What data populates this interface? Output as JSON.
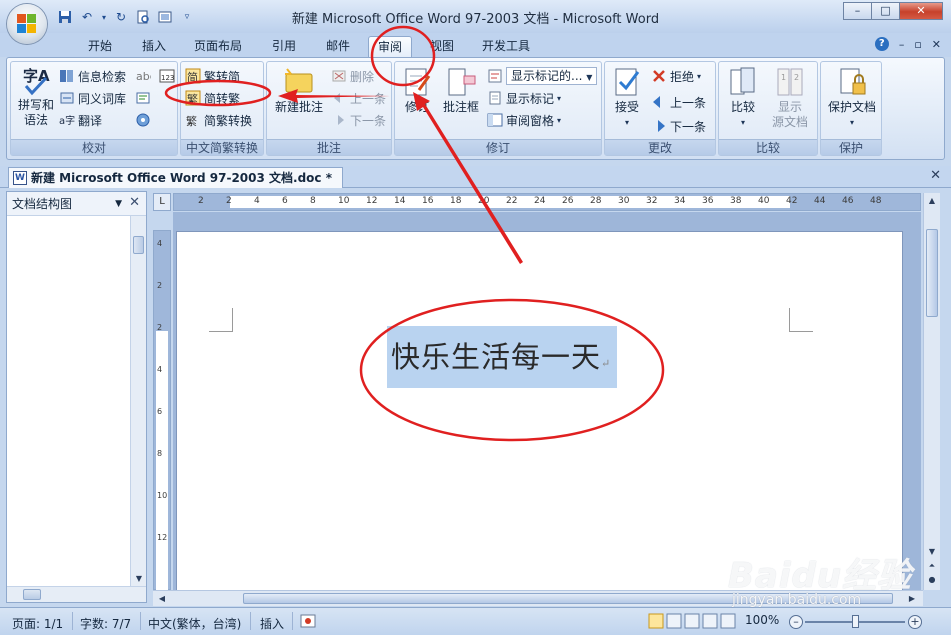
{
  "titlebar": {
    "title": "新建 Microsoft Office Word 97-2003 文档 - Microsoft Word",
    "controls": {
      "minimize": "–",
      "maximize": "□",
      "close": "✕"
    }
  },
  "tabs": [
    {
      "label": "开始",
      "active": false
    },
    {
      "label": "插入",
      "active": false
    },
    {
      "label": "页面布局",
      "active": false
    },
    {
      "label": "引用",
      "active": false
    },
    {
      "label": "邮件",
      "active": false
    },
    {
      "label": "审阅",
      "active": true
    },
    {
      "label": "视图",
      "active": false
    },
    {
      "label": "开发工具",
      "active": false
    }
  ],
  "ribbon": {
    "proofing": {
      "label": "校对",
      "spell": "拼写和\n语法",
      "research": "信息检索",
      "thesaurus": "同义词库",
      "translate": "翻译"
    },
    "chinese_conversion": {
      "label": "中文简繁转换",
      "to_simplified": "繁转简",
      "to_traditional": "简转繁",
      "convert": "简繁转换"
    },
    "comments": {
      "label": "批注",
      "new_comment": "新建批注",
      "delete": "删除",
      "previous": "上一条",
      "next": "下一条"
    },
    "tracking": {
      "label": "修订",
      "track_changes": "修订",
      "balloons": "批注框",
      "display_for_review": "显示标记的...",
      "show_markup": "显示标记",
      "reviewing_pane": "审阅窗格"
    },
    "changes": {
      "label": "更改",
      "accept": "接受",
      "reject": "拒绝",
      "previous": "上一条",
      "next": "下一条"
    },
    "compare": {
      "label": "比较",
      "compare": "比较",
      "show_source": "显示\n源文档"
    },
    "protect": {
      "label": "保护",
      "protect_document": "保护文档"
    }
  },
  "document_tab": "新建 Microsoft Office Word 97-2003 文档.doc *",
  "nav_pane": {
    "mode": "文档结构图"
  },
  "ruler": {
    "h_ticks": [
      "2",
      "2",
      "4",
      "6",
      "8",
      "10",
      "12",
      "14",
      "16",
      "18",
      "20",
      "22",
      "24",
      "26",
      "28",
      "30",
      "32",
      "34",
      "36",
      "38",
      "40",
      "42",
      "44",
      "46",
      "48"
    ],
    "v_ticks": [
      "4",
      "2",
      "2",
      "4",
      "6",
      "8",
      "10",
      "12"
    ],
    "corner": "L"
  },
  "document": {
    "selected_text": "快乐生活每一天",
    "para_mark": "↵"
  },
  "status": {
    "page": "页面: 1/1",
    "words": "字数: 7/7",
    "language": "中文(繁体，台湾)",
    "mode": "插入",
    "zoom": "100%"
  },
  "watermark": {
    "logo": "Baidu经验",
    "url": "jingyan.baidu.com"
  },
  "colors": {
    "annotation": "#e02020",
    "selection": "#b9d3f0",
    "ribbon_bg": "#dde8f6"
  }
}
